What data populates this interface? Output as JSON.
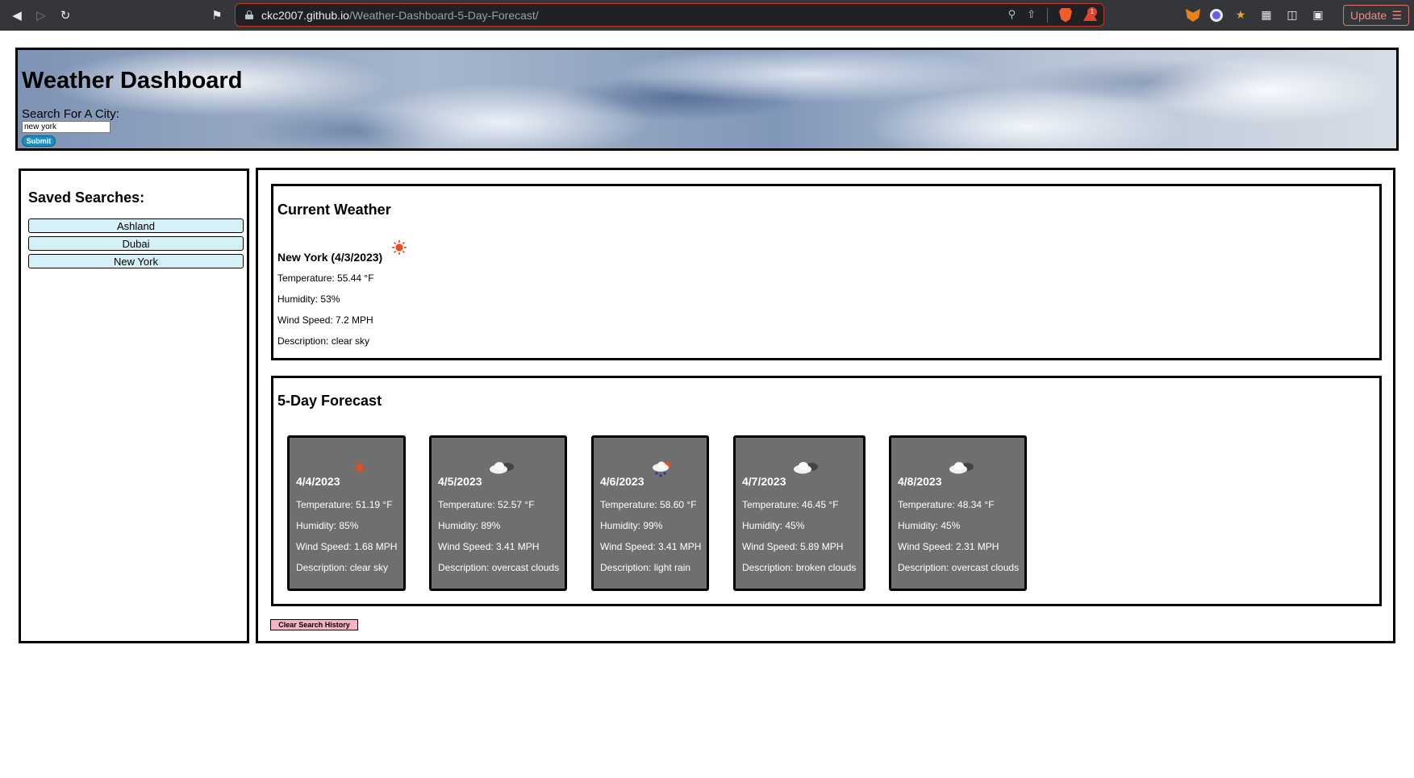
{
  "browser": {
    "url_host": "ckc2007.github.io",
    "url_path": "/Weather-Dashboard-5-Day-Forecast/",
    "badge_count": "1",
    "update_label": "Update"
  },
  "header": {
    "title": "Weather Dashboard",
    "search_label": "Search For A City:",
    "search_value": "new york",
    "submit_label": "Submit"
  },
  "sidebar": {
    "title": "Saved Searches:",
    "items": [
      "Ashland",
      "Dubai",
      "New York"
    ]
  },
  "current": {
    "title": "Current Weather",
    "city_date": "New York (4/3/2023)",
    "icon": "sun-icon",
    "temperature": "Temperature: 55.44 °F",
    "humidity": "Humidity: 53%",
    "wind": "Wind Speed: 7.2 MPH",
    "description": "Description: clear sky"
  },
  "forecast": {
    "title": "5-Day Forecast",
    "days": [
      {
        "date": "4/4/2023",
        "icon": "sun-icon",
        "temperature": "Temperature: 51.19 °F",
        "humidity": "Humidity: 85%",
        "wind": "Wind Speed: 1.68 MPH",
        "description": "Description: clear sky"
      },
      {
        "date": "4/5/2023",
        "icon": "cloud-icon",
        "temperature": "Temperature: 52.57 °F",
        "humidity": "Humidity: 89%",
        "wind": "Wind Speed: 3.41 MPH",
        "description": "Description: overcast clouds"
      },
      {
        "date": "4/6/2023",
        "icon": "rain-icon",
        "temperature": "Temperature: 58.60 °F",
        "humidity": "Humidity: 99%",
        "wind": "Wind Speed: 3.41 MPH",
        "description": "Description: light rain"
      },
      {
        "date": "4/7/2023",
        "icon": "cloud-icon",
        "temperature": "Temperature: 46.45 °F",
        "humidity": "Humidity: 45%",
        "wind": "Wind Speed: 5.89 MPH",
        "description": "Description: broken clouds"
      },
      {
        "date": "4/8/2023",
        "icon": "cloud-icon",
        "temperature": "Temperature: 48.34 °F",
        "humidity": "Humidity: 45%",
        "wind": "Wind Speed: 2.31 MPH",
        "description": "Description: overcast clouds"
      }
    ]
  },
  "clear_label": "Clear Search History"
}
